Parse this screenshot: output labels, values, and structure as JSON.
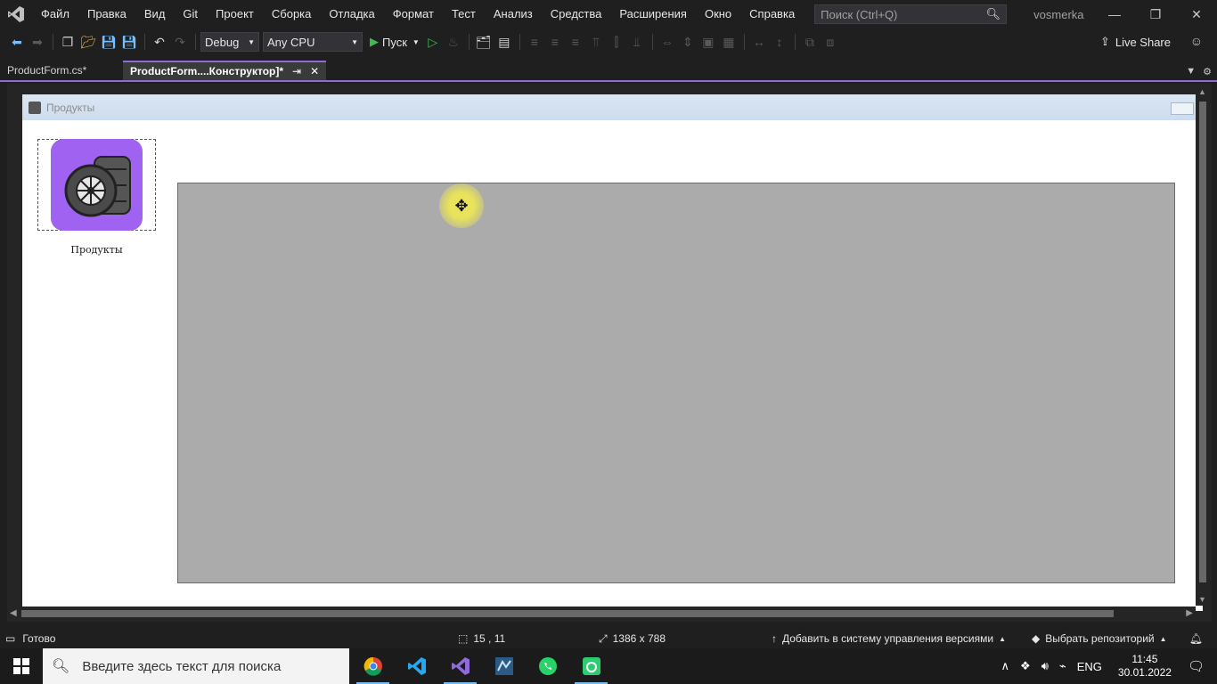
{
  "menu": {
    "items": [
      "Файл",
      "Правка",
      "Вид",
      "Git",
      "Проект",
      "Сборка",
      "Отладка",
      "Формат",
      "Тест",
      "Анализ",
      "Средства",
      "Расширения",
      "Окно",
      "Справка"
    ],
    "search_placeholder": "Поиск (Ctrl+Q)",
    "solution_name": "vosmerka"
  },
  "toolbar": {
    "config": "Debug",
    "platform": "Any CPU",
    "run_label": "Пуск",
    "live_share": "Live Share"
  },
  "tabs": [
    {
      "label": "ProductForm.cs*",
      "active": false
    },
    {
      "label": "ProductForm....Конструктор]*",
      "active": true
    }
  ],
  "form": {
    "title": "Продукты",
    "nav_button_label": "Продукты"
  },
  "status": {
    "ready": "Готово",
    "position": "15 , 11",
    "size": "1386 x 788",
    "vcs": "Добавить в систему управления версиями",
    "repo": "Выбрать репозиторий"
  },
  "taskbar": {
    "search_placeholder": "Введите здесь текст для поиска",
    "language": "ENG",
    "time": "11:45",
    "date": "30.01.2022"
  },
  "colors": {
    "accent": "#8e6bd8",
    "logo_bg": "#a062f0",
    "panel_grey": "#ababab"
  }
}
